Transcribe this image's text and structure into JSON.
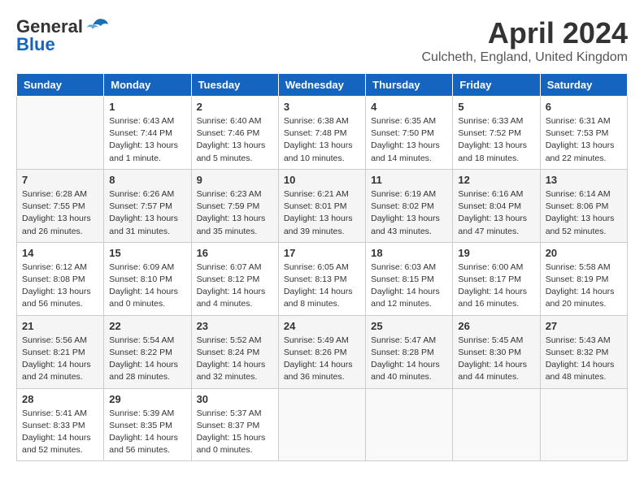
{
  "header": {
    "logo_line1": "General",
    "logo_line2": "Blue",
    "title": "April 2024",
    "subtitle": "Culcheth, England, United Kingdom"
  },
  "days_of_week": [
    "Sunday",
    "Monday",
    "Tuesday",
    "Wednesday",
    "Thursday",
    "Friday",
    "Saturday"
  ],
  "weeks": [
    [
      {
        "day": "",
        "empty": true
      },
      {
        "day": "1",
        "sunrise": "6:43 AM",
        "sunset": "7:44 PM",
        "daylight": "13 hours and 1 minute."
      },
      {
        "day": "2",
        "sunrise": "6:40 AM",
        "sunset": "7:46 PM",
        "daylight": "13 hours and 5 minutes."
      },
      {
        "day": "3",
        "sunrise": "6:38 AM",
        "sunset": "7:48 PM",
        "daylight": "13 hours and 10 minutes."
      },
      {
        "day": "4",
        "sunrise": "6:35 AM",
        "sunset": "7:50 PM",
        "daylight": "13 hours and 14 minutes."
      },
      {
        "day": "5",
        "sunrise": "6:33 AM",
        "sunset": "7:52 PM",
        "daylight": "13 hours and 18 minutes."
      },
      {
        "day": "6",
        "sunrise": "6:31 AM",
        "sunset": "7:53 PM",
        "daylight": "13 hours and 22 minutes."
      }
    ],
    [
      {
        "day": "7",
        "sunrise": "6:28 AM",
        "sunset": "7:55 PM",
        "daylight": "13 hours and 26 minutes."
      },
      {
        "day": "8",
        "sunrise": "6:26 AM",
        "sunset": "7:57 PM",
        "daylight": "13 hours and 31 minutes."
      },
      {
        "day": "9",
        "sunrise": "6:23 AM",
        "sunset": "7:59 PM",
        "daylight": "13 hours and 35 minutes."
      },
      {
        "day": "10",
        "sunrise": "6:21 AM",
        "sunset": "8:01 PM",
        "daylight": "13 hours and 39 minutes."
      },
      {
        "day": "11",
        "sunrise": "6:19 AM",
        "sunset": "8:02 PM",
        "daylight": "13 hours and 43 minutes."
      },
      {
        "day": "12",
        "sunrise": "6:16 AM",
        "sunset": "8:04 PM",
        "daylight": "13 hours and 47 minutes."
      },
      {
        "day": "13",
        "sunrise": "6:14 AM",
        "sunset": "8:06 PM",
        "daylight": "13 hours and 52 minutes."
      }
    ],
    [
      {
        "day": "14",
        "sunrise": "6:12 AM",
        "sunset": "8:08 PM",
        "daylight": "13 hours and 56 minutes."
      },
      {
        "day": "15",
        "sunrise": "6:09 AM",
        "sunset": "8:10 PM",
        "daylight": "14 hours and 0 minutes."
      },
      {
        "day": "16",
        "sunrise": "6:07 AM",
        "sunset": "8:12 PM",
        "daylight": "14 hours and 4 minutes."
      },
      {
        "day": "17",
        "sunrise": "6:05 AM",
        "sunset": "8:13 PM",
        "daylight": "14 hours and 8 minutes."
      },
      {
        "day": "18",
        "sunrise": "6:03 AM",
        "sunset": "8:15 PM",
        "daylight": "14 hours and 12 minutes."
      },
      {
        "day": "19",
        "sunrise": "6:00 AM",
        "sunset": "8:17 PM",
        "daylight": "14 hours and 16 minutes."
      },
      {
        "day": "20",
        "sunrise": "5:58 AM",
        "sunset": "8:19 PM",
        "daylight": "14 hours and 20 minutes."
      }
    ],
    [
      {
        "day": "21",
        "sunrise": "5:56 AM",
        "sunset": "8:21 PM",
        "daylight": "14 hours and 24 minutes."
      },
      {
        "day": "22",
        "sunrise": "5:54 AM",
        "sunset": "8:22 PM",
        "daylight": "14 hours and 28 minutes."
      },
      {
        "day": "23",
        "sunrise": "5:52 AM",
        "sunset": "8:24 PM",
        "daylight": "14 hours and 32 minutes."
      },
      {
        "day": "24",
        "sunrise": "5:49 AM",
        "sunset": "8:26 PM",
        "daylight": "14 hours and 36 minutes."
      },
      {
        "day": "25",
        "sunrise": "5:47 AM",
        "sunset": "8:28 PM",
        "daylight": "14 hours and 40 minutes."
      },
      {
        "day": "26",
        "sunrise": "5:45 AM",
        "sunset": "8:30 PM",
        "daylight": "14 hours and 44 minutes."
      },
      {
        "day": "27",
        "sunrise": "5:43 AM",
        "sunset": "8:32 PM",
        "daylight": "14 hours and 48 minutes."
      }
    ],
    [
      {
        "day": "28",
        "sunrise": "5:41 AM",
        "sunset": "8:33 PM",
        "daylight": "14 hours and 52 minutes."
      },
      {
        "day": "29",
        "sunrise": "5:39 AM",
        "sunset": "8:35 PM",
        "daylight": "14 hours and 56 minutes."
      },
      {
        "day": "30",
        "sunrise": "5:37 AM",
        "sunset": "8:37 PM",
        "daylight": "15 hours and 0 minutes."
      },
      {
        "day": "",
        "empty": true
      },
      {
        "day": "",
        "empty": true
      },
      {
        "day": "",
        "empty": true
      },
      {
        "day": "",
        "empty": true
      }
    ]
  ],
  "labels": {
    "sunrise": "Sunrise:",
    "sunset": "Sunset:",
    "daylight": "Daylight:"
  }
}
